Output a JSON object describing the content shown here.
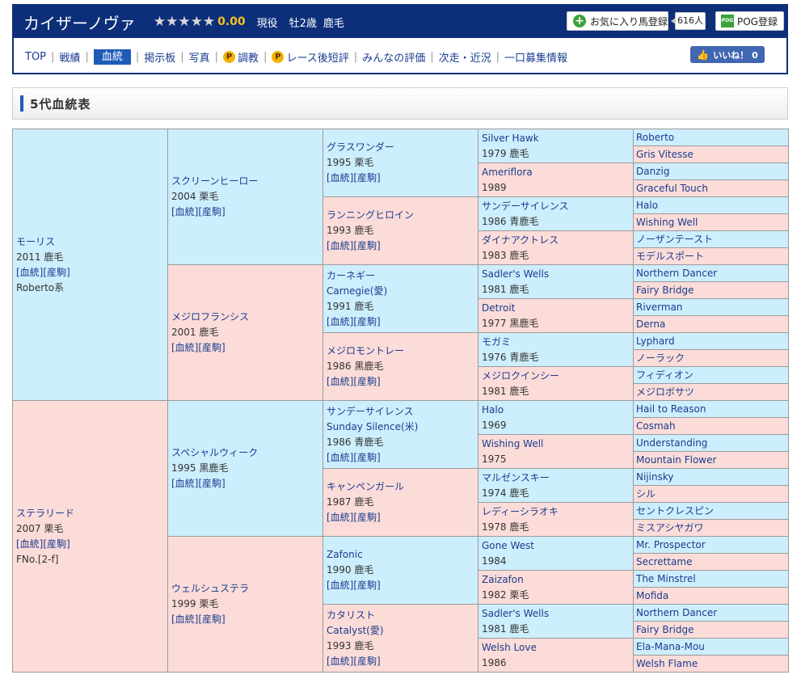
{
  "header": {
    "horse_name": "カイザーノヴァ",
    "star_count": 5,
    "rating": "0.00",
    "status": "現役",
    "sex_age": "牡2歳",
    "coat": "鹿毛",
    "fav_label": "お気に入り馬登録",
    "fav_count": "616人",
    "pog_label": "POG登録",
    "pog_icon_text": "POG",
    "like_label": "いいね！ 0"
  },
  "nav": {
    "items": [
      "TOP",
      "戦績",
      "血統",
      "掲示板",
      "写真",
      "調教",
      "レース後短評",
      "みんなの評価",
      "次走・近況",
      "一口募集情報"
    ],
    "active_index": 2,
    "p_icon": "P"
  },
  "section": {
    "title": "5代血統表"
  },
  "links": {
    "blood": "[血統]",
    "foal": "[産駒]"
  },
  "pedigree": {
    "g1": [
      {
        "name": "モーリス",
        "info": "2011 鹿毛",
        "extra": "Roberto系",
        "sex": "m",
        "red": false
      },
      {
        "name": "ステラリード",
        "info": "2007 栗毛",
        "extra": "FNo.[2-f]",
        "sex": "f",
        "red": false
      }
    ],
    "g2": [
      {
        "name": "スクリーンヒーロー",
        "info": "2004 栗毛",
        "sex": "m",
        "red": false
      },
      {
        "name": "メジロフランシス",
        "info": "2001 鹿毛",
        "sex": "f",
        "red": false
      },
      {
        "name": "スペシャルウィーク",
        "info": "1995 黒鹿毛",
        "sex": "m",
        "red": false
      },
      {
        "name": "ウェルシュステラ",
        "info": "1999 栗毛",
        "sex": "f",
        "red": false
      }
    ],
    "g3": [
      {
        "name": "グラスワンダー",
        "alt": "",
        "info": "1995 栗毛",
        "sex": "m",
        "red": false
      },
      {
        "name": "ランニングヒロイン",
        "alt": "",
        "info": "1993 鹿毛",
        "sex": "f",
        "red": false
      },
      {
        "name": "カーネギー",
        "alt": "Carnegie(愛)",
        "info": "1991 鹿毛",
        "sex": "m",
        "red": false
      },
      {
        "name": "メジロモントレー",
        "alt": "",
        "info": "1986 黒鹿毛",
        "sex": "f",
        "red": false
      },
      {
        "name": "サンデーサイレンス",
        "alt": "Sunday Silence(米)",
        "info": "1986 青鹿毛",
        "sex": "m",
        "red": true
      },
      {
        "name": "キャンペンガール",
        "alt": "",
        "info": "1987 鹿毛",
        "sex": "f",
        "red": false
      },
      {
        "name": "Zafonic",
        "alt": "",
        "info": "1990 鹿毛",
        "sex": "m",
        "red": false
      },
      {
        "name": "カタリスト",
        "alt": "Catalyst(愛)",
        "info": "1993 鹿毛",
        "sex": "f",
        "red": false
      }
    ],
    "g4": [
      {
        "name": "Silver Hawk",
        "info": "1979 鹿毛",
        "sex": "m",
        "red": false
      },
      {
        "name": "Ameriflora",
        "info": "1989",
        "sex": "f",
        "red": false
      },
      {
        "name": "サンデーサイレンス",
        "info": "1986 青鹿毛",
        "sex": "m",
        "red": true
      },
      {
        "name": "ダイナアクトレス",
        "info": "1983 鹿毛",
        "sex": "f",
        "red": false
      },
      {
        "name": "Sadler's Wells",
        "info": "1981 鹿毛",
        "sex": "m",
        "red": true
      },
      {
        "name": "Detroit",
        "info": "1977 黒鹿毛",
        "sex": "f",
        "red": false
      },
      {
        "name": "モガミ",
        "info": "1976 青鹿毛",
        "sex": "m",
        "red": false
      },
      {
        "name": "メジロクインシー",
        "info": "1981 鹿毛",
        "sex": "f",
        "red": false
      },
      {
        "name": "Halo",
        "info": "1969",
        "sex": "m",
        "red": false
      },
      {
        "name": "Wishing Well",
        "info": "1975",
        "sex": "f",
        "red": false
      },
      {
        "name": "マルゼンスキー",
        "info": "1974 鹿毛",
        "sex": "m",
        "red": false
      },
      {
        "name": "レディーシラオキ",
        "info": "1978 鹿毛",
        "sex": "f",
        "red": false
      },
      {
        "name": "Gone West",
        "info": "1984",
        "sex": "m",
        "red": false
      },
      {
        "name": "Zaizafon",
        "info": "1982 栗毛",
        "sex": "f",
        "red": false
      },
      {
        "name": "Sadler's Wells",
        "info": "1981 鹿毛",
        "sex": "m",
        "red": true
      },
      {
        "name": "Welsh Love",
        "info": "1986",
        "sex": "f",
        "red": false
      }
    ],
    "g5": [
      {
        "name": "Roberto",
        "sex": "m"
      },
      {
        "name": "Gris Vitesse",
        "sex": "f"
      },
      {
        "name": "Danzig",
        "sex": "m"
      },
      {
        "name": "Graceful Touch",
        "sex": "f"
      },
      {
        "name": "Halo",
        "sex": "m"
      },
      {
        "name": "Wishing Well",
        "sex": "f"
      },
      {
        "name": "ノーザンテースト",
        "sex": "m"
      },
      {
        "name": "モデルスポート",
        "sex": "f"
      },
      {
        "name": "Northern Dancer",
        "sex": "m"
      },
      {
        "name": "Fairy Bridge",
        "sex": "f"
      },
      {
        "name": "Riverman",
        "sex": "m"
      },
      {
        "name": "Derna",
        "sex": "f"
      },
      {
        "name": "Lyphard",
        "sex": "m"
      },
      {
        "name": "ノーラック",
        "sex": "f"
      },
      {
        "name": "フィディオン",
        "sex": "m"
      },
      {
        "name": "メジロボサツ",
        "sex": "f"
      },
      {
        "name": "Hail to Reason",
        "sex": "m"
      },
      {
        "name": "Cosmah",
        "sex": "f"
      },
      {
        "name": "Understanding",
        "sex": "m"
      },
      {
        "name": "Mountain Flower",
        "sex": "f"
      },
      {
        "name": "Nijinsky",
        "sex": "m"
      },
      {
        "name": "シル",
        "sex": "f"
      },
      {
        "name": "セントクレスピン",
        "sex": "m"
      },
      {
        "name": "ミスアシヤガワ",
        "sex": "f"
      },
      {
        "name": "Mr. Prospector",
        "sex": "m"
      },
      {
        "name": "Secrettame",
        "sex": "f"
      },
      {
        "name": "The Minstrel",
        "sex": "m"
      },
      {
        "name": "Mofida",
        "sex": "f"
      },
      {
        "name": "Northern Dancer",
        "sex": "m"
      },
      {
        "name": "Fairy Bridge",
        "sex": "f"
      },
      {
        "name": "Ela-Mana-Mou",
        "sex": "m"
      },
      {
        "name": "Welsh Flame",
        "sex": "f"
      }
    ]
  },
  "colors": {
    "male_bg": "#cdeefc",
    "female_bg": "#fcdcd8",
    "header_blue": "#0d2f7a",
    "link": "#1a3c8f",
    "highlight_red": "#d21414"
  }
}
